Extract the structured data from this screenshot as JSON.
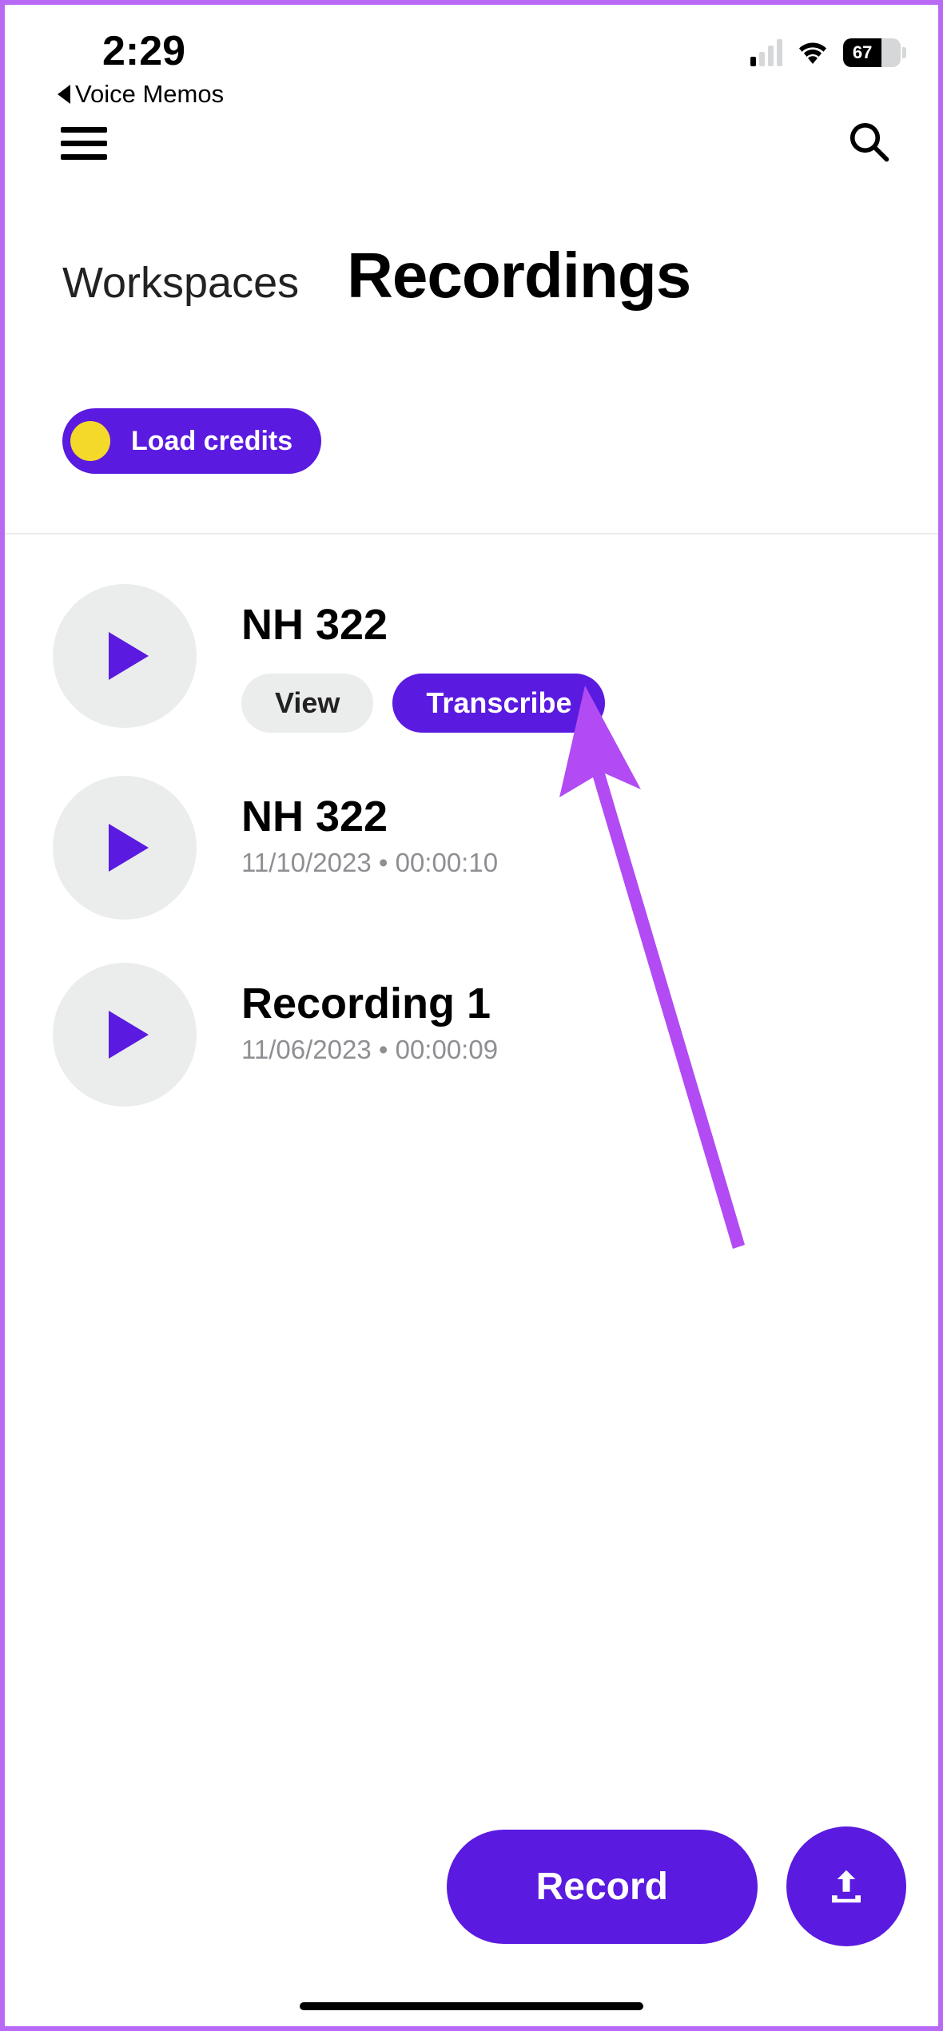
{
  "status": {
    "time": "2:29",
    "back_label": "Voice Memos",
    "battery": "67"
  },
  "page": {
    "workspaces_label": "Workspaces",
    "title": "Recordings"
  },
  "credits": {
    "label": "Load credits"
  },
  "recordings": [
    {
      "name": "NH 322",
      "expanded": true,
      "view_label": "View",
      "transcribe_label": "Transcribe"
    },
    {
      "name": "NH 322",
      "meta": "11/10/2023 • 00:00:10"
    },
    {
      "name": "Recording 1",
      "meta": "11/06/2023 • 00:00:09"
    }
  ],
  "bottom": {
    "record_label": "Record"
  }
}
